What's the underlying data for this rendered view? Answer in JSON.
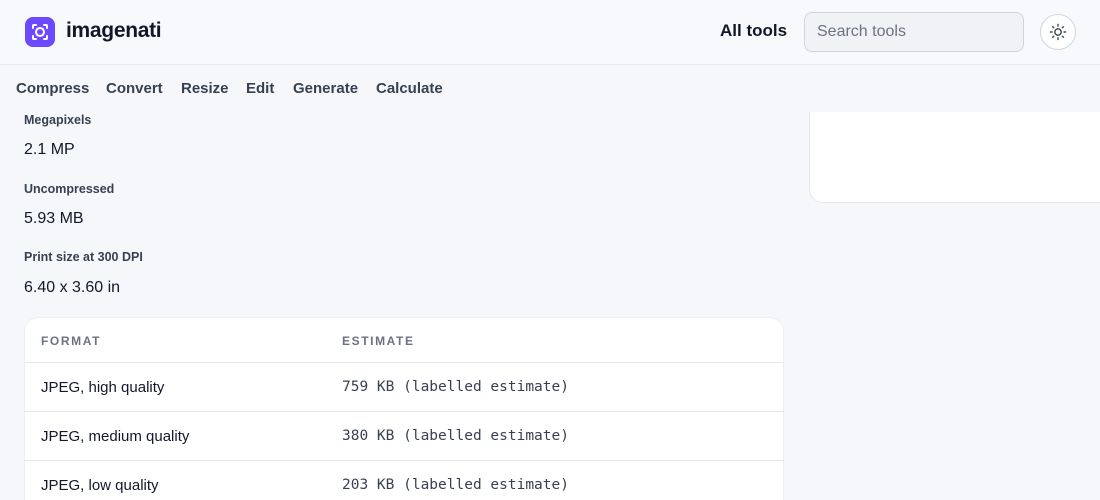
{
  "header": {
    "logo_text": "imagenati",
    "all_tools_label": "All tools",
    "search_placeholder": "Search tools",
    "accent_color": "#6d4aff"
  },
  "nav": {
    "items": [
      "Compress",
      "Convert",
      "Resize",
      "Edit",
      "Generate",
      "Calculate"
    ]
  },
  "stats": [
    {
      "label": "Megapixels",
      "value": "2.1 MP"
    },
    {
      "label": "Uncompressed",
      "value": "5.93 MB"
    },
    {
      "label": "Print size at 300 DPI",
      "value": "6.40 x 3.60 in"
    }
  ],
  "table": {
    "headers": [
      "FORMAT",
      "ESTIMATE"
    ],
    "rows": [
      {
        "format": "JPEG, high quality",
        "estimate": "759 KB (labelled estimate)"
      },
      {
        "format": "JPEG, medium quality",
        "estimate": "380 KB (labelled estimate)"
      },
      {
        "format": "JPEG, low quality",
        "estimate": "203 KB (labelled estimate)"
      }
    ]
  }
}
